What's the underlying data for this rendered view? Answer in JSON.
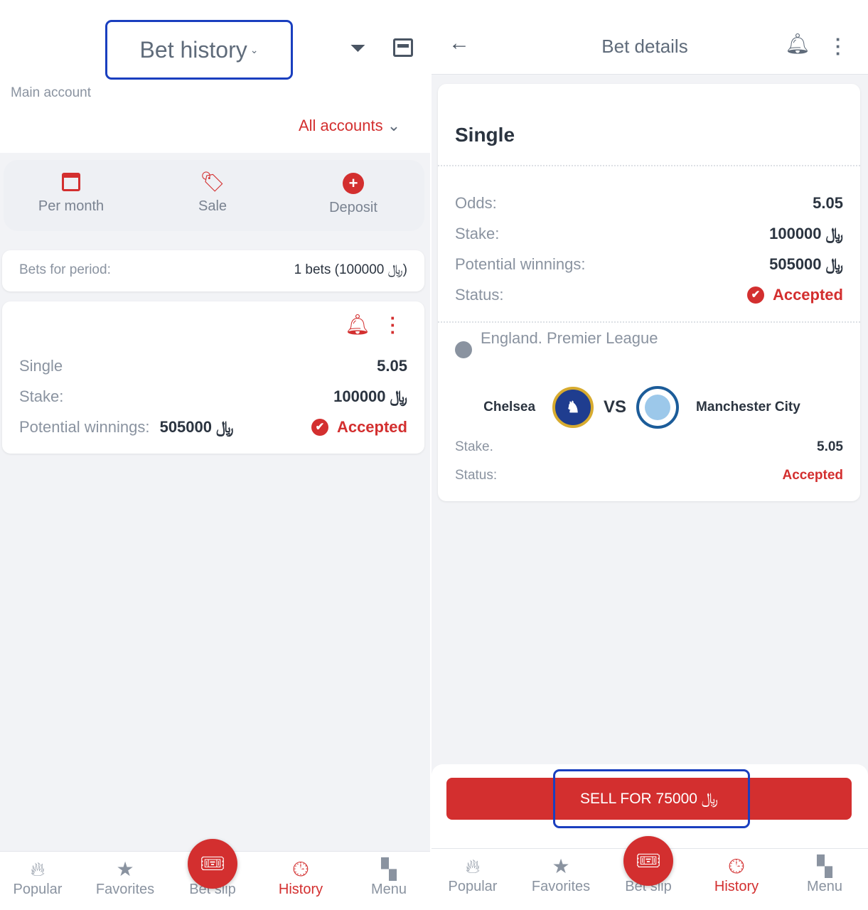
{
  "currency": "﷼",
  "left": {
    "title": "Bet history",
    "account_label": "Main account",
    "accounts_dropdown": "All accounts",
    "quick_actions": [
      {
        "label": "Per month",
        "icon": "calendar-icon"
      },
      {
        "label": "Sale",
        "icon": "tag-icon"
      },
      {
        "label": "Deposit",
        "icon": "plus-circle-icon"
      }
    ],
    "period": {
      "label": "Bets for period:",
      "value": "1 bets (﷼ 100000)"
    },
    "bet": {
      "type": "Single",
      "odds": "5.05",
      "stake_label": "Stake:",
      "stake": "﷼ 100000",
      "winnings_label": "Potential winnings:",
      "winnings": "﷼ 505000",
      "status": "Accepted"
    }
  },
  "right": {
    "title": "Bet details",
    "bet_type": "Single",
    "rows": [
      {
        "label": "Odds:",
        "value": "5.05"
      },
      {
        "label": "Stake:",
        "value": "﷼ 100000"
      },
      {
        "label": "Potential winnings:",
        "value": "﷼ 505000"
      },
      {
        "label": "Status:",
        "value": "Accepted"
      }
    ],
    "league": "England. Premier League",
    "home_team": "Chelsea",
    "vs": "VS",
    "away_team": "Manchester City",
    "event_stake_label": "Stake.",
    "event_odds": "5.05",
    "event_status_label": "Status:",
    "event_status": "Accepted",
    "sell_button": "SELL FOR 75000 ﷼"
  },
  "nav": [
    {
      "label": "Popular",
      "icon": "flame-icon"
    },
    {
      "label": "Favorites",
      "icon": "star-icon"
    },
    {
      "label": "Bet slip",
      "icon": "ticket-icon"
    },
    {
      "label": "History",
      "icon": "clock-icon",
      "active": true
    },
    {
      "label": "Menu",
      "icon": "grid-icon"
    }
  ],
  "colors": {
    "accent": "#d32f2f",
    "highlight": "#1a3fbf",
    "background": "#f2f3f6"
  }
}
